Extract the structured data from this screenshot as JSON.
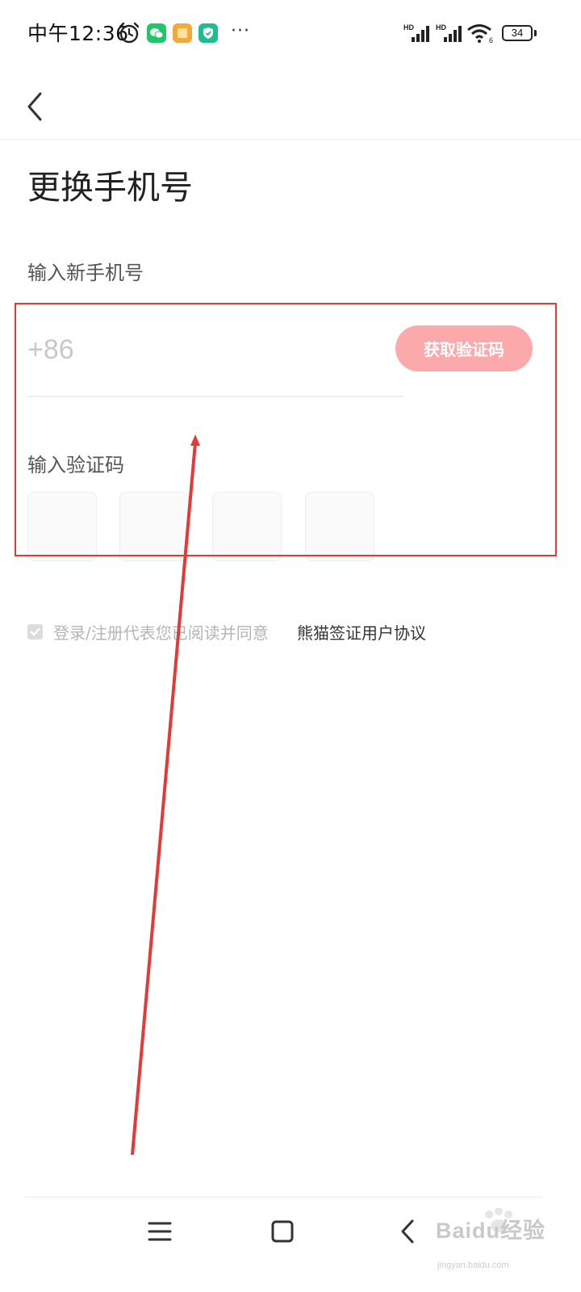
{
  "status_bar": {
    "time": "中午12:36",
    "more": "···",
    "signal_label_1": "HD",
    "signal_label_2": "HD",
    "battery": "34",
    "icons": [
      "alarm-icon",
      "wechat-icon",
      "note-icon",
      "shield-icon",
      "signal-icon",
      "signal-icon",
      "wifi-icon",
      "battery-icon"
    ]
  },
  "header": {
    "back_icon": "chevron-left-icon",
    "title": "更换手机号"
  },
  "form": {
    "phone_label": "输入新手机号",
    "phone_placeholder": "+86",
    "phone_value": "",
    "get_code_button": "获取验证码",
    "code_label": "输入验证码",
    "code_boxes": [
      "",
      "",
      "",
      ""
    ]
  },
  "agreement": {
    "checked": true,
    "text": "登录/注册代表您已阅读并同意",
    "link": "熊猫签证用户协议"
  },
  "nav_bar": {
    "icons": [
      "menu-icon",
      "home-square-icon",
      "back-icon"
    ]
  },
  "watermark": {
    "main": "Baidu经验",
    "sub": "jingyan.baidu.com"
  },
  "colors": {
    "accent_button": "#fca9ab",
    "annotation_red": "#e53935"
  }
}
